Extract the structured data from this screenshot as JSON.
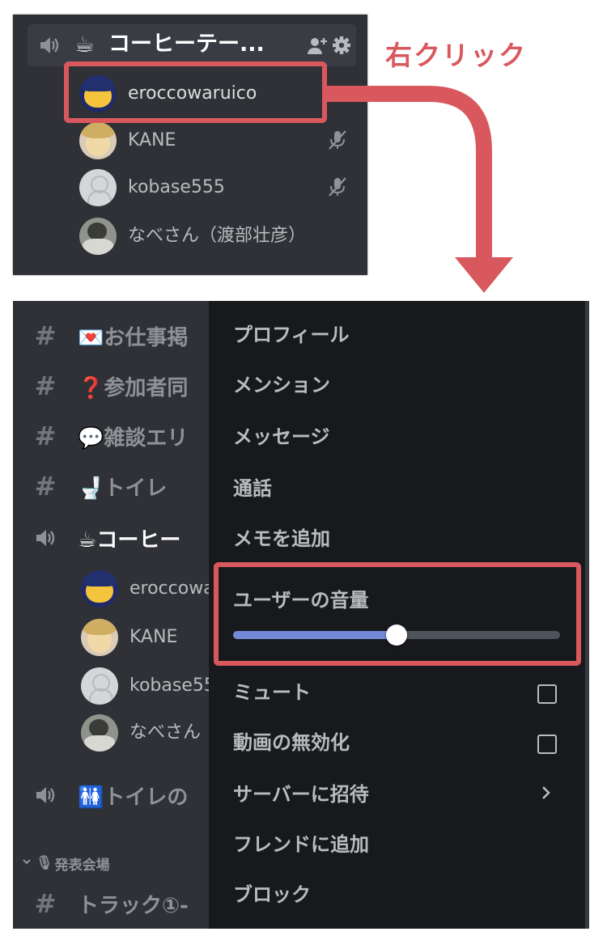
{
  "annotation": {
    "label": "右クリック",
    "color": "#d9585e"
  },
  "top_panel": {
    "voice_channel": {
      "emoji": "☕",
      "name": "コーヒーテー..."
    },
    "members": [
      {
        "name": "eroccowaruico",
        "avatar": "avatar-eroccowaruico",
        "muted": false,
        "selected": true
      },
      {
        "name": "KANE",
        "avatar": "avatar-kane",
        "muted": true
      },
      {
        "name": "kobase555",
        "avatar": "avatar-kobase555",
        "muted": true
      },
      {
        "name": "なべさん（渡部壮彦）",
        "avatar": "avatar-nabe",
        "muted": false
      }
    ]
  },
  "bottom_panel": {
    "channels": [
      {
        "emoji": "💌",
        "name": "お仕事掲"
      },
      {
        "emoji": "❓",
        "name": "参加者同"
      },
      {
        "emoji": "💬",
        "name": "雑談エリ"
      },
      {
        "emoji": "🚽",
        "name": "トイレ"
      }
    ],
    "voice_channel": {
      "emoji": "☕",
      "name": "コーヒー"
    },
    "members": [
      {
        "name": "eroccowa"
      },
      {
        "name": "KANE"
      },
      {
        "name": "kobase55"
      },
      {
        "name": "なべさん"
      }
    ],
    "voice_channel_2": {
      "emoji": "🚻",
      "name": "トイレの"
    },
    "category": {
      "emoji": "🎙",
      "name": "発表会場"
    },
    "last_channel": {
      "name": "トラック①-"
    }
  },
  "context_menu": {
    "items_top": [
      "プロフィール",
      "メンション",
      "メッセージ",
      "通話",
      "メモを追加"
    ],
    "volume": {
      "label": "ユーザーの音量",
      "value_fraction": 0.5
    },
    "mute": {
      "label": "ミュート",
      "checked": false
    },
    "disable_video": {
      "label": "動画の無効化",
      "checked": false
    },
    "invite": {
      "label": "サーバーに招待",
      "submenu": true
    },
    "add_friend": "フレンドに追加",
    "block": "ブロック"
  },
  "colors": {
    "highlight": "#d9585e",
    "panel_bg": "#2f3136",
    "menu_bg": "#18191c",
    "slider_fill": "#7289da"
  }
}
